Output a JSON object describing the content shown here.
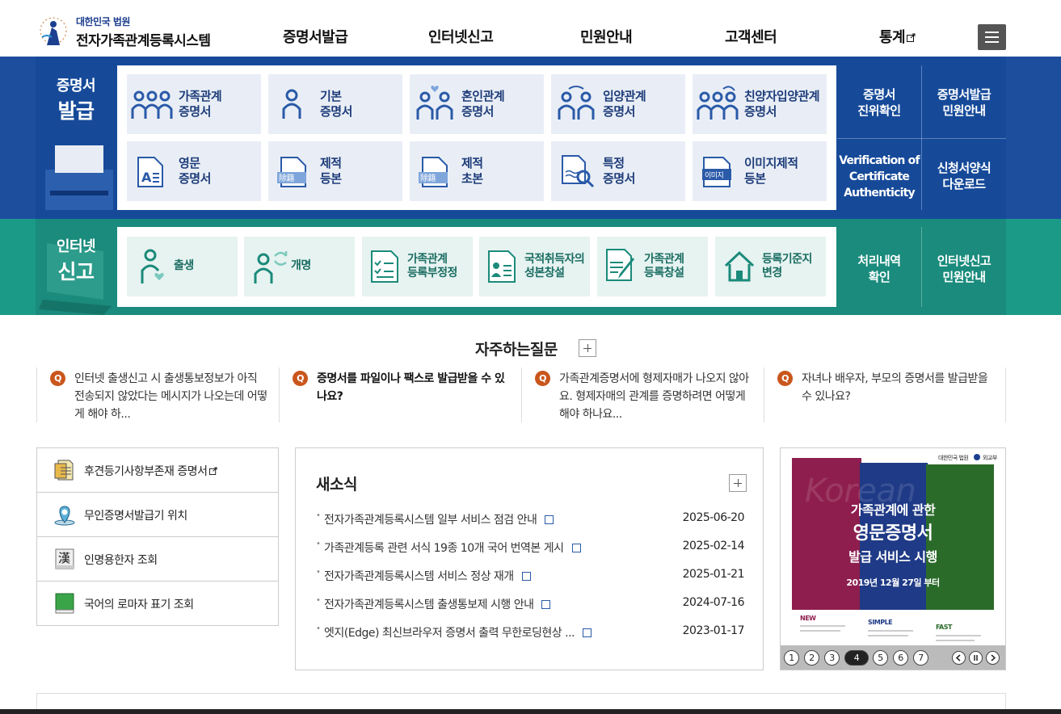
{
  "header": {
    "org": "대한민국 법원",
    "site_title": "전자가족관계등록시스템",
    "nav": [
      "증명서발급",
      "인터넷신고",
      "민원안내",
      "고객센터",
      "통계"
    ]
  },
  "cert": {
    "title1": "증명서",
    "title2": "발급",
    "cards": [
      {
        "l1": "가족관계",
        "l2": "증명서",
        "icon": "family-icon"
      },
      {
        "l1": "기본",
        "l2": "증명서",
        "icon": "person-icon"
      },
      {
        "l1": "혼인관계",
        "l2": "증명서",
        "icon": "marriage-icon"
      },
      {
        "l1": "입양관계",
        "l2": "증명서",
        "icon": "adoption-icon"
      },
      {
        "l1": "친양자입양관계",
        "l2": "증명서",
        "icon": "full-adoption-icon"
      },
      {
        "l1": "영문",
        "l2": "증명서",
        "icon": "english-doc-icon"
      },
      {
        "l1": "제적",
        "l2": "등본",
        "icon": "removed-register-icon"
      },
      {
        "l1": "제적",
        "l2": "초본",
        "icon": "removed-extract-icon"
      },
      {
        "l1": "특정",
        "l2": "증명서",
        "icon": "search-doc-icon"
      },
      {
        "l1": "이미지제적",
        "l2": "등본",
        "icon": "image-register-icon"
      }
    ],
    "doc_badge": "除籍",
    "img_badge": "이미지",
    "side": [
      {
        "l1": "증명서",
        "l2": "진위확인"
      },
      {
        "l1": "증명서발급",
        "l2": "민원안내"
      },
      {
        "l1": "Verification of",
        "l2": "Certificate",
        "l3": "Authenticity"
      },
      {
        "l1": "신청서양식",
        "l2": "다운로드"
      }
    ]
  },
  "report": {
    "title1": "인터넷",
    "title2": "신고",
    "cards": [
      {
        "l1": "출생",
        "l2": "",
        "icon": "birth-icon"
      },
      {
        "l1": "개명",
        "l2": "",
        "icon": "rename-icon"
      },
      {
        "l1": "가족관계",
        "l2": "등록부정정",
        "icon": "checklist-icon"
      },
      {
        "l1": "국적취득자의",
        "l2": "성본창설",
        "icon": "id-card-icon"
      },
      {
        "l1": "가족관계",
        "l2": "등록창설",
        "icon": "pen-doc-icon"
      },
      {
        "l1": "등록기준지",
        "l2": "변경",
        "icon": "house-icon"
      }
    ],
    "side": [
      {
        "l1": "처리내역",
        "l2": "확인"
      },
      {
        "l1": "인터넷신고",
        "l2": "민원안내"
      }
    ]
  },
  "faq": {
    "title": "자주하는질문",
    "q_mark": "Q",
    "items": [
      "인터넷 출생신고 시 출생통보정보가 아직 전송되지 않았다는 메시지가 나오는데 어떻게 해야 하...",
      "증명서를 파일이나 팩스로 발급받을 수 있나요?",
      "가족관계증명서에 형제자매가 나오지 않아요. 형제자매의 관계를 증명하려면 어떻게 해야 하나요...",
      "자녀나 배우자, 부모의 증명서를 발급받을 수 있나요?"
    ]
  },
  "quick": [
    {
      "label": "후견등기사항부존재 증명서",
      "icon": "document-icon"
    },
    {
      "label": "무인증명서발급기 위치",
      "icon": "location-pin-icon"
    },
    {
      "label": "인명용한자 조회",
      "icon": "hanja-book-icon"
    },
    {
      "label": "국어의 로마자 표기 조회",
      "icon": "green-book-icon"
    }
  ],
  "hanja_glyph": "漢",
  "news": {
    "title": "새소식",
    "items": [
      {
        "title": "전자가족관계등록시스템 일부 서비스 점검 안내",
        "date": "2025-06-20"
      },
      {
        "title": "가족관계등록 관련 서식 19종 10개 국어 번역본 게시",
        "date": "2025-02-14"
      },
      {
        "title": "전자가족관계등록시스템 서비스 정상 재개",
        "date": "2025-01-21"
      },
      {
        "title": "전자가족관계등록시스템 출생통보제 시행 안내",
        "date": "2024-07-16"
      },
      {
        "title": "엣지(Edge) 최신브라우저 증명서 출력 무한로딩현상 ...",
        "date": "2023-01-17"
      }
    ]
  },
  "banner": {
    "org": "대한민국 법원",
    "org2": "외교부",
    "bg_word": "Korean",
    "line1": "가족관계에 관한",
    "line2": "영문증명서",
    "line3": "발급 서비스 시행",
    "date": "2019년 12월 27일 부터",
    "tags": [
      "NEW",
      "SIMPLE",
      "FAST"
    ],
    "pages": [
      "1",
      "2",
      "3",
      "4",
      "5",
      "6",
      "7"
    ],
    "active_page": "4"
  },
  "colors": {
    "blue": "#164a99",
    "teal": "#1a8b7c",
    "accent": "#c9561c"
  }
}
